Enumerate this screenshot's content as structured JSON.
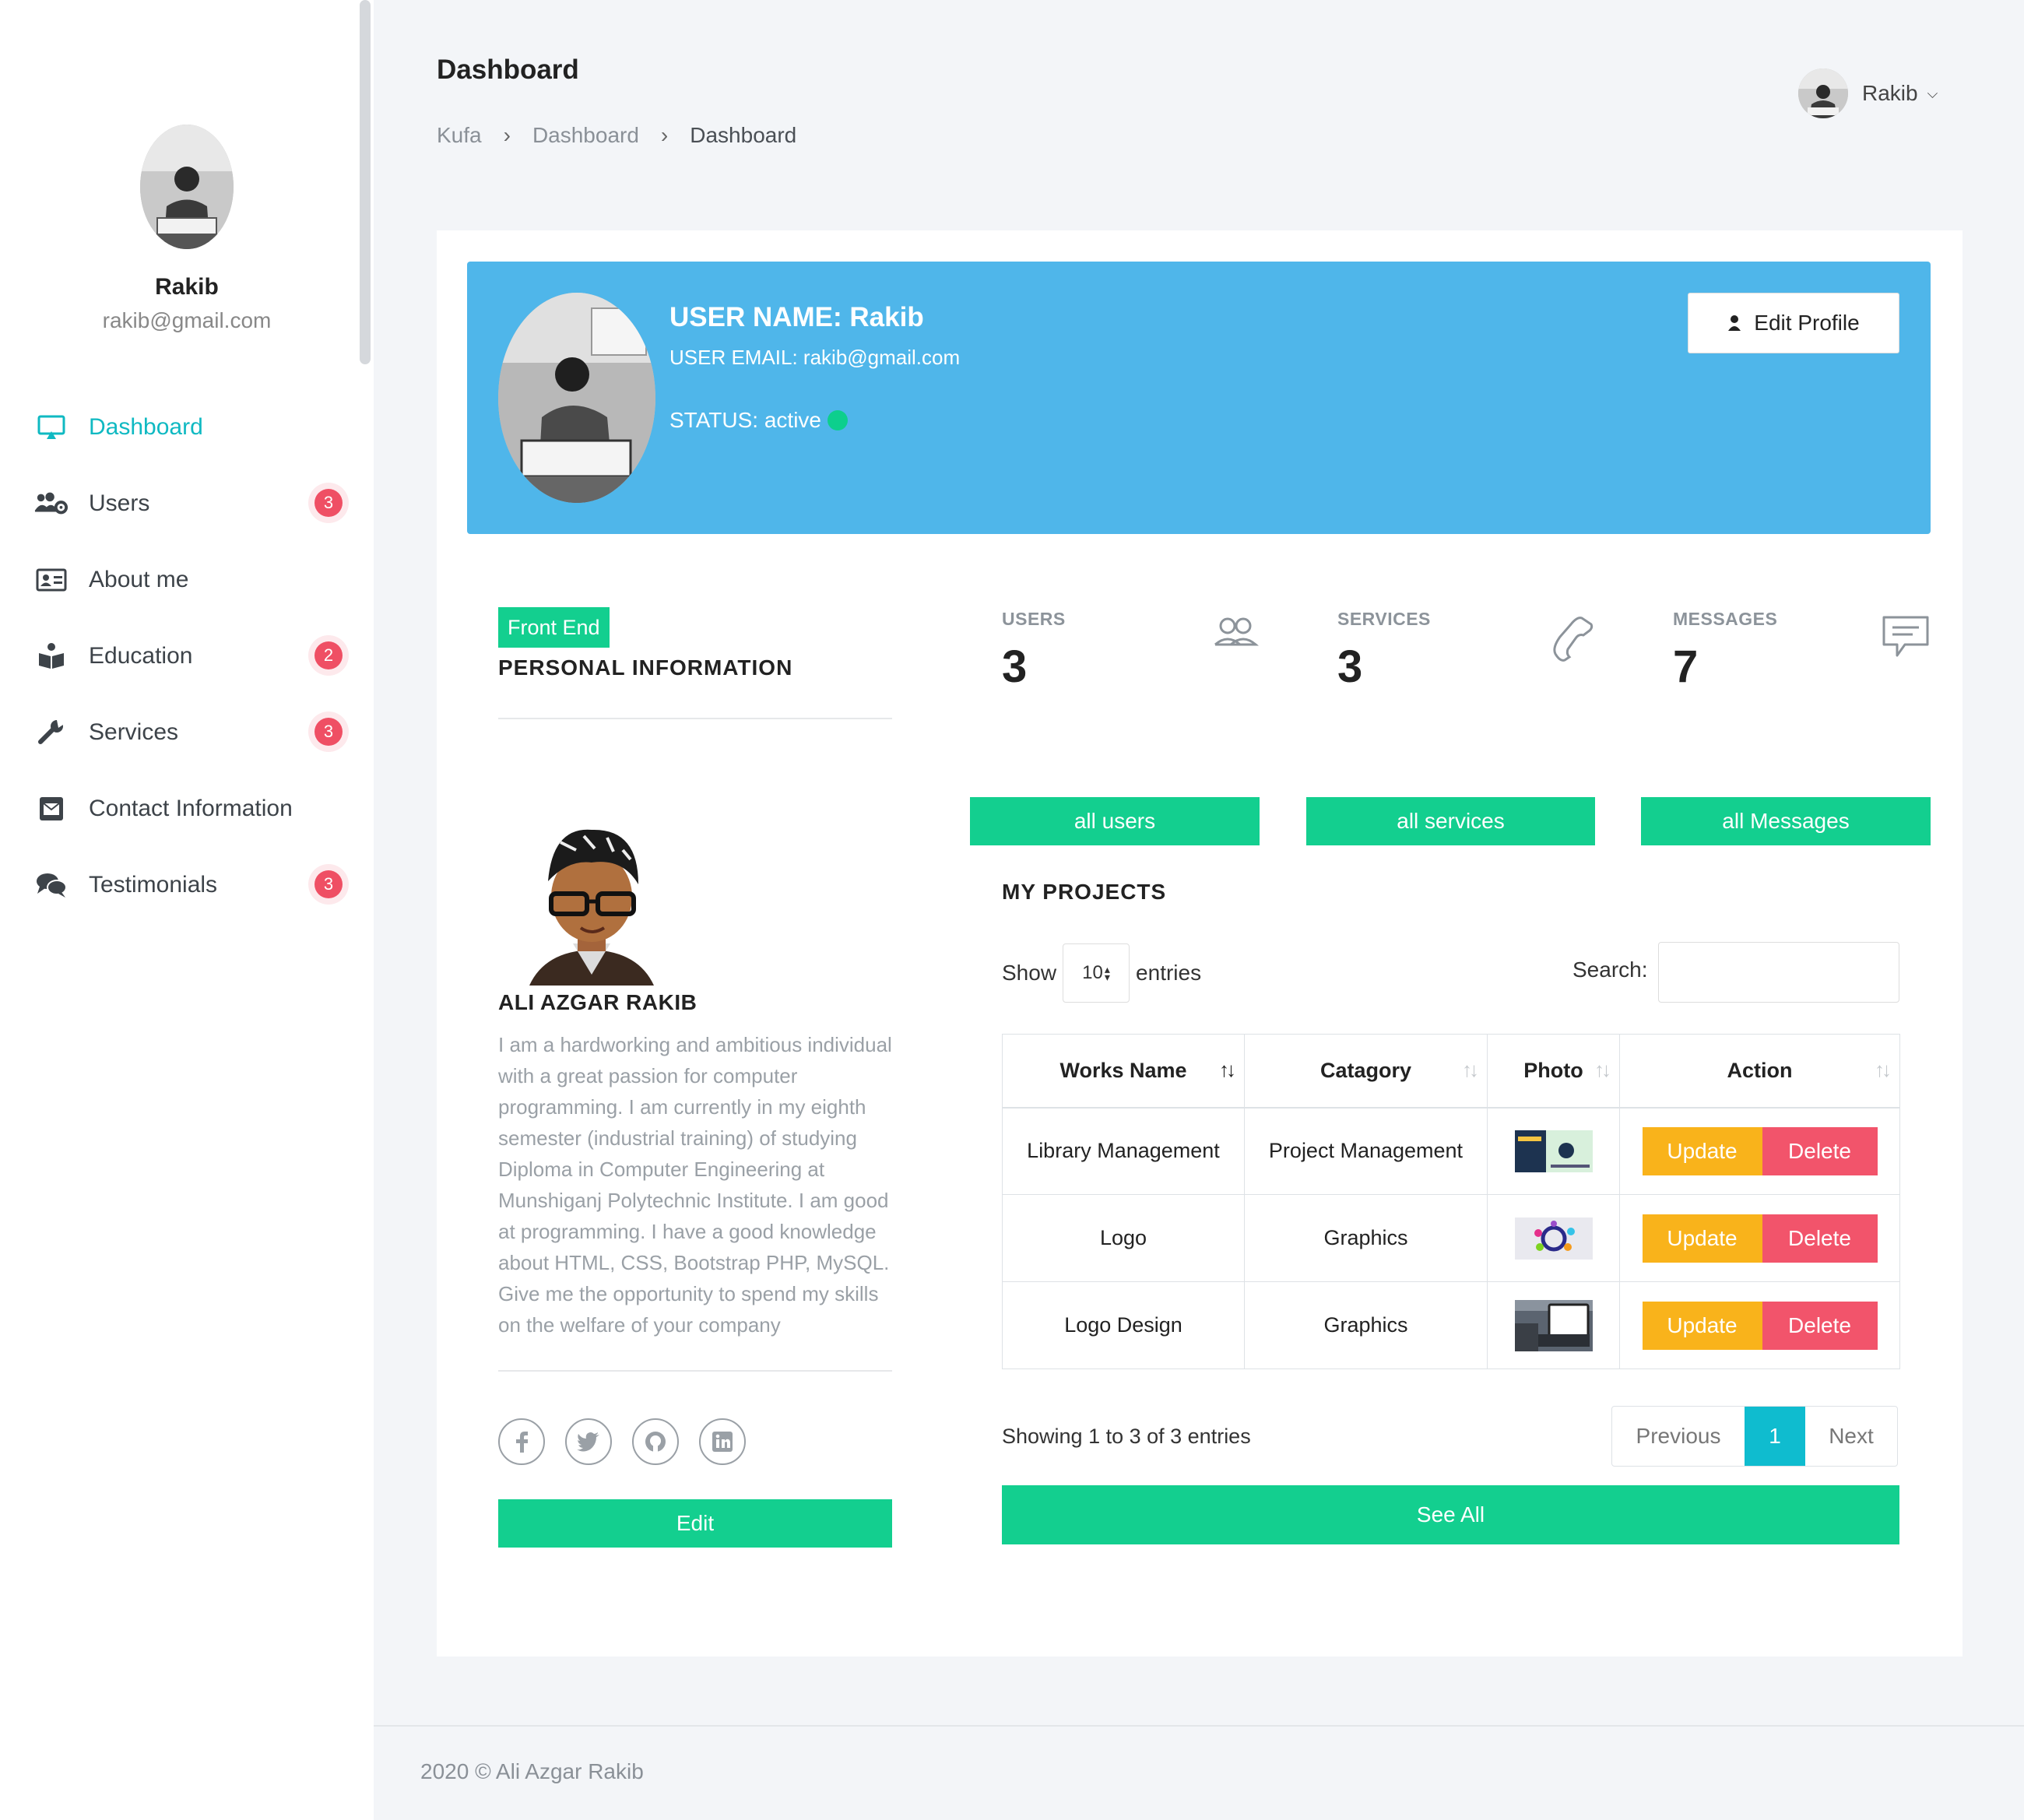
{
  "sidebar": {
    "user_name": "Rakib",
    "user_email": "rakib@gmail.com",
    "items": [
      {
        "label": "Dashboard",
        "icon": "monitor-icon",
        "active": true,
        "badge": ""
      },
      {
        "label": "Users",
        "icon": "users-gear-icon",
        "badge": "3"
      },
      {
        "label": "About me",
        "icon": "id-card-icon",
        "badge": ""
      },
      {
        "label": "Education",
        "icon": "book-reader-icon",
        "badge": "2"
      },
      {
        "label": "Services",
        "icon": "wrench-icon",
        "badge": "3"
      },
      {
        "label": "Contact Information",
        "icon": "envelope-icon",
        "badge": ""
      },
      {
        "label": "Testimonials",
        "icon": "comments-icon",
        "badge": "3"
      }
    ]
  },
  "header": {
    "title": "Dashboard",
    "breadcrumb": [
      "Kufa",
      "Dashboard",
      "Dashboard"
    ],
    "user_menu_name": "Rakib"
  },
  "banner": {
    "user_name": "USER NAME: Rakib",
    "user_email": "USER EMAIL: rakib@gmail.com",
    "status": "STATUS: active",
    "status_color": "#0dcf8d",
    "edit_profile_label": "Edit Profile",
    "bg_color": "#4fb6ea"
  },
  "profile": {
    "tag": "Front End",
    "section_title": "PERSONAL INFORMATION",
    "name": "ALI AZGAR RAKIB",
    "bio": "I am a hardworking and ambitious individual with a great passion for computer programming. I am currently in my eighth semester (industrial training) of studying Diploma in Computer Engineering at Munshiganj Polytechnic Institute. I am good at programming. I have a good knowledge about HTML, CSS, Bootstrap PHP, MySQL. Give me the opportunity to spend my skills on the welfare of your company",
    "socials": [
      "facebook-icon",
      "twitter-icon",
      "github-icon",
      "linkedin-icon"
    ],
    "edit_label": "Edit"
  },
  "stats": [
    {
      "label": "USERS",
      "value": "3",
      "icon": "users-outline-icon",
      "button": "all users"
    },
    {
      "label": "SERVICES",
      "value": "3",
      "icon": "phone-icon",
      "button": "all services"
    },
    {
      "label": "MESSAGES",
      "value": "7",
      "icon": "message-icon",
      "button": "all Messages"
    }
  ],
  "projects": {
    "title": "MY PROJECTS",
    "show_label": "Show",
    "entries_value": "10",
    "entries_label": "entries",
    "search_label": "Search:",
    "columns": [
      "Works Name",
      "Catagory",
      "Photo",
      "Action"
    ],
    "rows": [
      {
        "name": "Library Management",
        "category": "Project Management",
        "photo": "library-thumbnail"
      },
      {
        "name": "Logo",
        "category": "Graphics",
        "photo": "logo-thumbnail"
      },
      {
        "name": "Logo Design",
        "category": "Graphics",
        "photo": "laptop-thumbnail"
      }
    ],
    "update_label": "Update",
    "delete_label": "Delete",
    "showing": "Showing 1 to 3 of 3 entries",
    "previous": "Previous",
    "page": "1",
    "next": "Next",
    "see_all": "See All"
  },
  "footer": {
    "text": "2020 © Ali Azgar Rakib"
  },
  "colors": {
    "accent": "#0fb9c2",
    "green": "#13cf8f",
    "update": "#f9b31b",
    "delete": "#f2546b",
    "badge": "#ef4f64"
  }
}
